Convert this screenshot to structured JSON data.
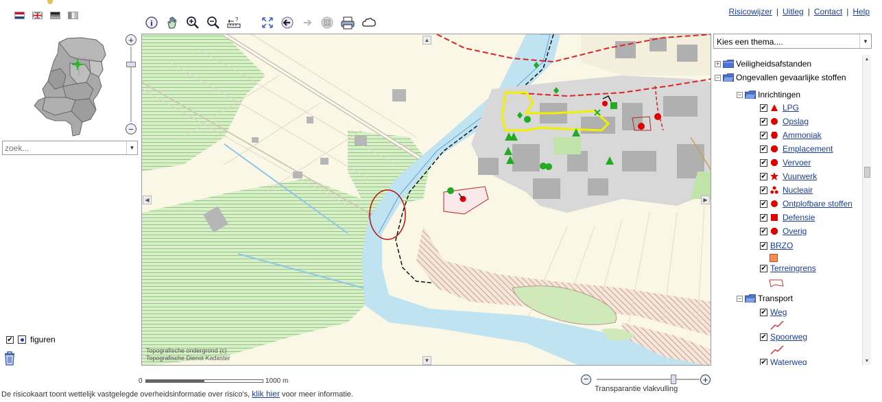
{
  "header": {
    "links": [
      "Risicowijzer",
      "Uitleg",
      "Contact",
      "Help"
    ],
    "separator": "|"
  },
  "flags": [
    "flag-nl-icon",
    "flag-uk-icon",
    "flag-de-icon",
    "flag-fr-icon"
  ],
  "toolbar": {
    "tools": [
      "info-icon",
      "pan-hand-icon",
      "zoom-in-icon",
      "zoom-out-icon",
      "measure-icon",
      "full-extent-icon",
      "back-icon",
      "forward-icon",
      "overview-icon",
      "print-icon",
      "cloud-draw-icon"
    ]
  },
  "search": {
    "placeholder": "zoek..."
  },
  "theme_select": {
    "value": "Kies een thema...."
  },
  "tree": {
    "nodes": [
      {
        "label": "Veiligheidsafstanden",
        "expand": "+"
      },
      {
        "label": "Ongevallen gevaarlijke stoffen",
        "expand": "−"
      },
      {
        "label": "Inrichtingen",
        "expand": "−"
      },
      {
        "label": "LPG"
      },
      {
        "label": "Opslag"
      },
      {
        "label": "Ammoniak"
      },
      {
        "label": "Emplacement"
      },
      {
        "label": "Vervoer"
      },
      {
        "label": "Vuurwerk"
      },
      {
        "label": "Nucleair"
      },
      {
        "label": "Ontplofbare stoffen"
      },
      {
        "label": "Defensie"
      },
      {
        "label": "Overig"
      },
      {
        "label": "BRZO"
      },
      {
        "label": "Terreingrens"
      },
      {
        "label": "Transport",
        "expand": "−"
      },
      {
        "label": "Weg"
      },
      {
        "label": "Spoorweg"
      },
      {
        "label": "Waterweg"
      }
    ],
    "checkmark": "✔"
  },
  "map": {
    "copyright_line1": "Topografische ondergrond (c)",
    "copyright_line2": "Topografische Dienst Kadaster"
  },
  "scalebar": {
    "start": "0",
    "end": "1000 m"
  },
  "transparency": {
    "label": "Transparantie vlakvulling",
    "minus": "−",
    "plus": "+",
    "level_percent": 88
  },
  "figuren": {
    "label": "figuren"
  },
  "footer": {
    "text_before": "De risicokaart toont wettelijk vastgelegde overheidsinformatie over risico's,",
    "link": "klik hier",
    "text_after": "voor meer informatie."
  },
  "colors": {
    "link": "#1a3d9a",
    "marker_red": "#e00000",
    "marker_green": "#22aa22",
    "highlight_yellow": "#f0f000"
  }
}
